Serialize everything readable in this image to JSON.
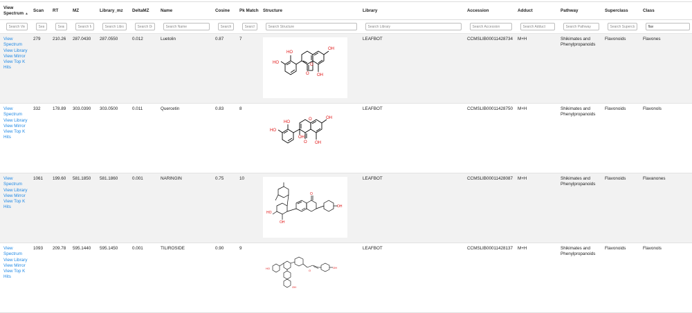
{
  "columns": [
    {
      "label": "View Spectrum",
      "sort": "▲",
      "placeholder": "Search View"
    },
    {
      "label": "Scan",
      "placeholder": "Search Scan"
    },
    {
      "label": "RT",
      "placeholder": "Search RT"
    },
    {
      "label": "MZ",
      "placeholder": "Search MZ"
    },
    {
      "label": "Library_mz",
      "placeholder": "Search Library_mz"
    },
    {
      "label": "DeltaMZ",
      "placeholder": "Search DeltaMZ"
    },
    {
      "label": "Name",
      "placeholder": "Search Name"
    },
    {
      "label": "Cosine",
      "placeholder": "Search Cosine"
    },
    {
      "label": "Pk Match",
      "placeholder": "Search Pk Match"
    },
    {
      "label": "Structure",
      "placeholder": "Search Structure"
    },
    {
      "label": "Library",
      "placeholder": "Search Library"
    },
    {
      "label": "Accession",
      "placeholder": "Search Accession"
    },
    {
      "label": "Adduct",
      "placeholder": "Search Adduct"
    },
    {
      "label": "Pathway",
      "placeholder": "Search Pathway"
    },
    {
      "label": "Superclass",
      "placeholder": "Search Superclass"
    },
    {
      "label": "Class",
      "placeholder": "Search Class",
      "value": "flav"
    }
  ],
  "links": [
    "View Spectrum",
    "View Library",
    "View Mirror",
    "View Top K Hits"
  ],
  "rows": [
    {
      "scan": "279",
      "rt": "210.26",
      "mz": "287.0430",
      "library_mz": "287.0550",
      "delta_mz": "0.012",
      "name": "Luetolin",
      "cosine": "0.87",
      "pk_match": "7",
      "library": "LEAFBOT",
      "accession": "CCMSLIB00011428734",
      "adduct": "M+H",
      "pathway": "Shikimates and Phenylpropanoids",
      "superclass": "Flavonoids",
      "class": "Flavones"
    },
    {
      "scan": "332",
      "rt": "178.89",
      "mz": "303.0390",
      "library_mz": "303.0500",
      "delta_mz": "0.011",
      "name": "Quercetin",
      "cosine": "0.83",
      "pk_match": "8",
      "library": "LEAFBOT",
      "accession": "CCMSLIB00011428750",
      "adduct": "M+H",
      "pathway": "Shikimates and Phenylpropanoids",
      "superclass": "Flavonoids",
      "class": "Flavonols"
    },
    {
      "scan": "1061",
      "rt": "199.60",
      "mz": "581.1850",
      "library_mz": "581.1860",
      "delta_mz": "0.001",
      "name": "NARINGIN",
      "cosine": "0.75",
      "pk_match": "10",
      "library": "LEAFBOT",
      "accession": "CCMSLIB00011428087",
      "adduct": "M+H",
      "pathway": "Shikimates and Phenylpropanoids",
      "superclass": "Flavonoids",
      "class": "Flavanones"
    },
    {
      "scan": "1093",
      "rt": "209.78",
      "mz": "595.1440",
      "library_mz": "595.1450",
      "delta_mz": "0.001",
      "name": "TILIROSIDE",
      "cosine": "0.90",
      "pk_match": "9",
      "library": "LEAFBOT",
      "accession": "CCMSLIB00011428137",
      "adduct": "M+H",
      "pathway": "Shikimates and Phenylpropanoids",
      "superclass": "Flavonoids",
      "class": "Flavonols"
    }
  ],
  "structure_labels": {
    "oh": "HO",
    "o": "O",
    "oh_r": "OH"
  },
  "colors": {
    "link": "#1e88e5",
    "odd_row": "#f2f2f2",
    "oxygen": "#e01010",
    "bond": "#000000"
  }
}
